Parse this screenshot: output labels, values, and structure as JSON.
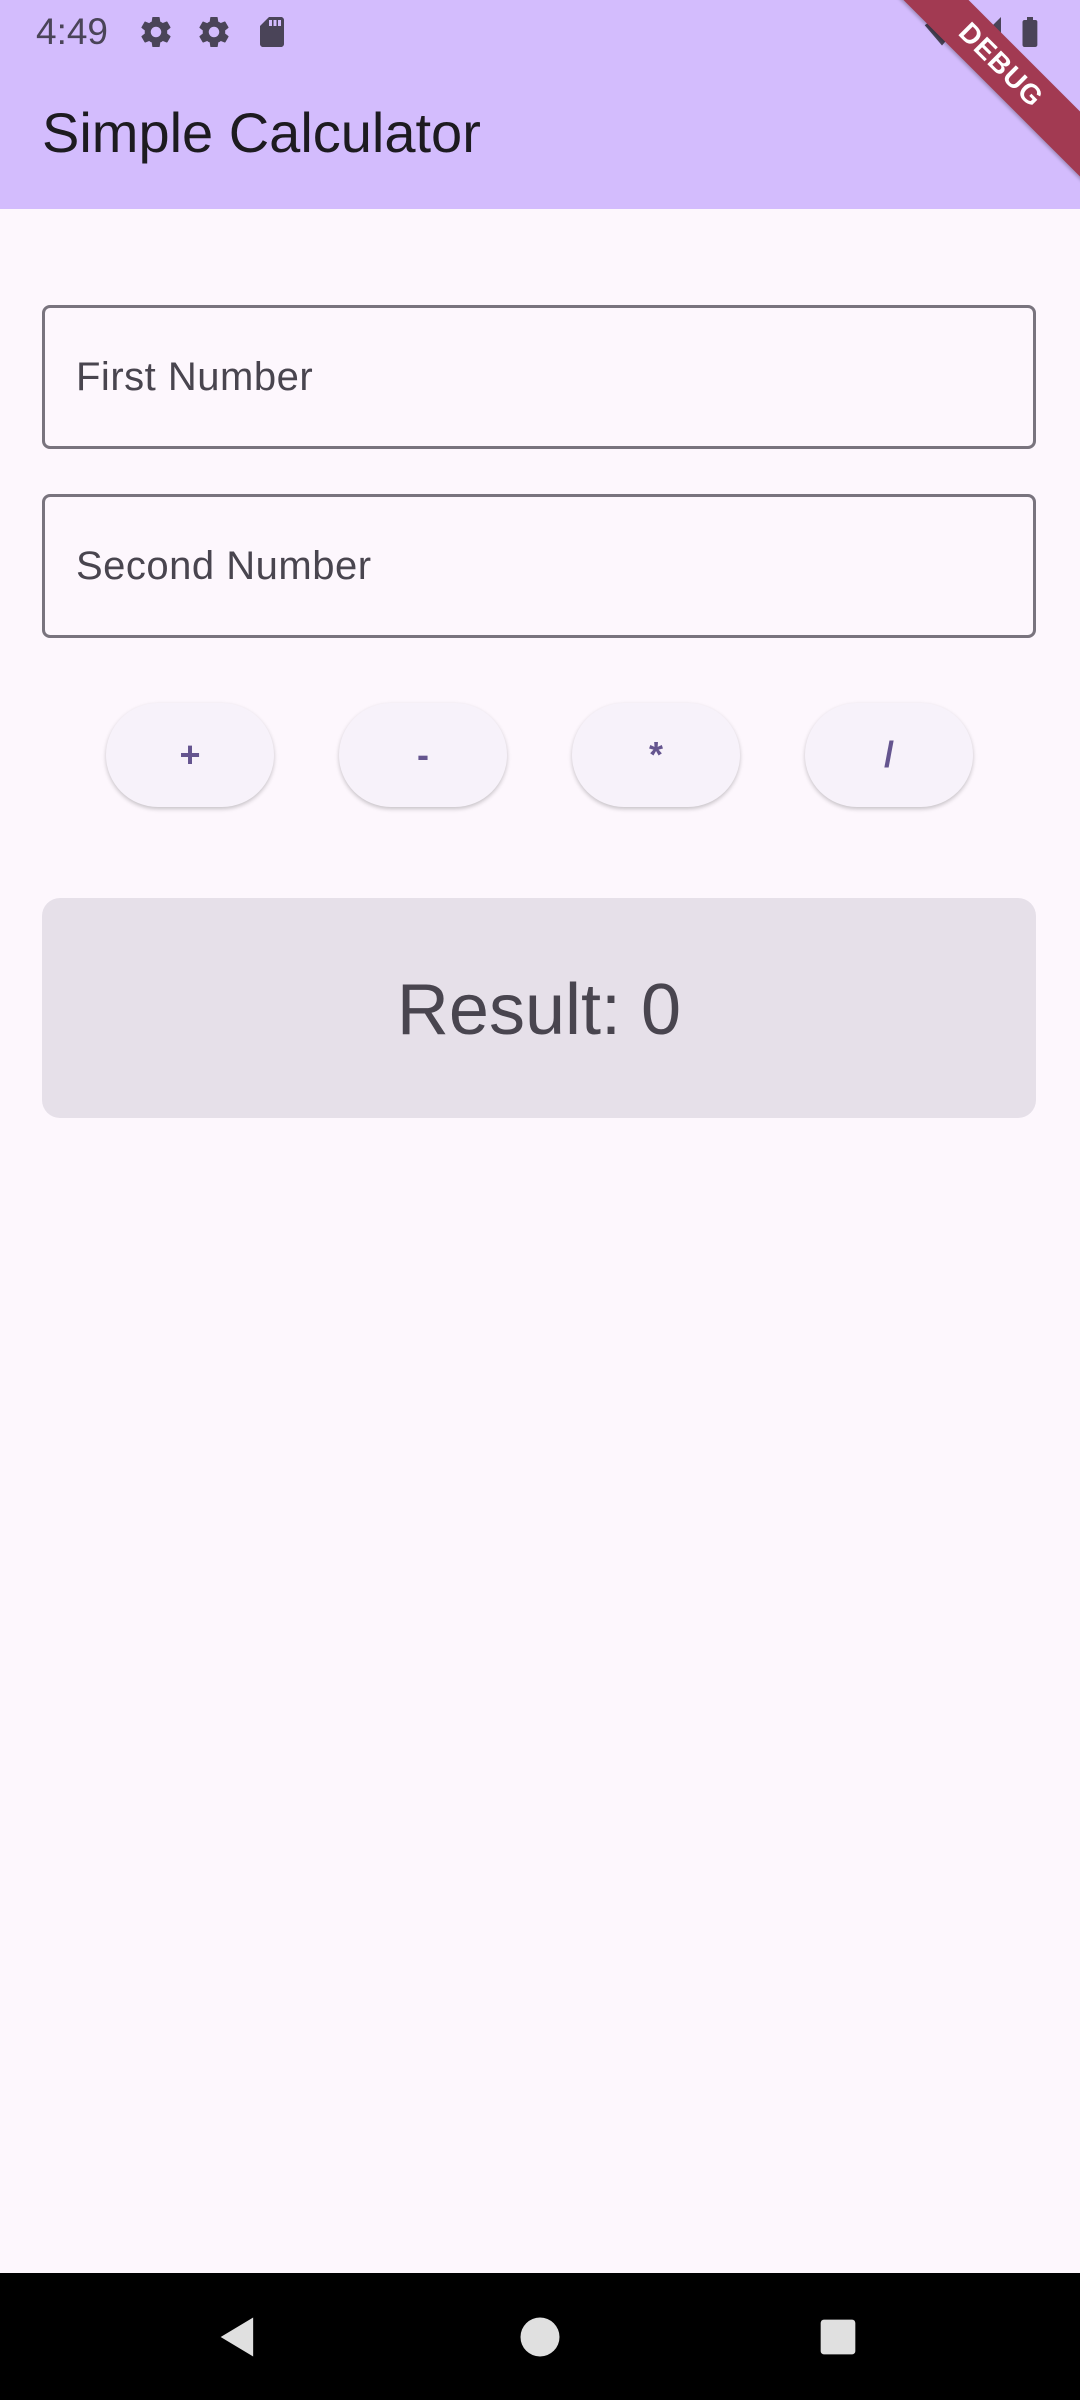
{
  "status_bar": {
    "time": "4:49",
    "icons": [
      "gear-icon",
      "gear-icon",
      "sd-card-icon",
      "wifi-icon",
      "signal-icon",
      "battery-icon"
    ]
  },
  "app_bar": {
    "title": "Simple Calculator",
    "debug_banner": "DEBUG",
    "background_color": "#d3bcfd"
  },
  "inputs": {
    "first_placeholder": "First Number",
    "second_placeholder": "Second Number"
  },
  "operators": {
    "add": "+",
    "subtract": "-",
    "multiply": "*",
    "divide": "/"
  },
  "result": {
    "text": "Result: 0"
  },
  "navigation": {
    "icons": [
      "back-icon",
      "home-icon",
      "recents-icon"
    ]
  },
  "colors": {
    "accent": "#65558f",
    "page_background": "#fdf7fd",
    "result_background": "#e6e0e9"
  }
}
